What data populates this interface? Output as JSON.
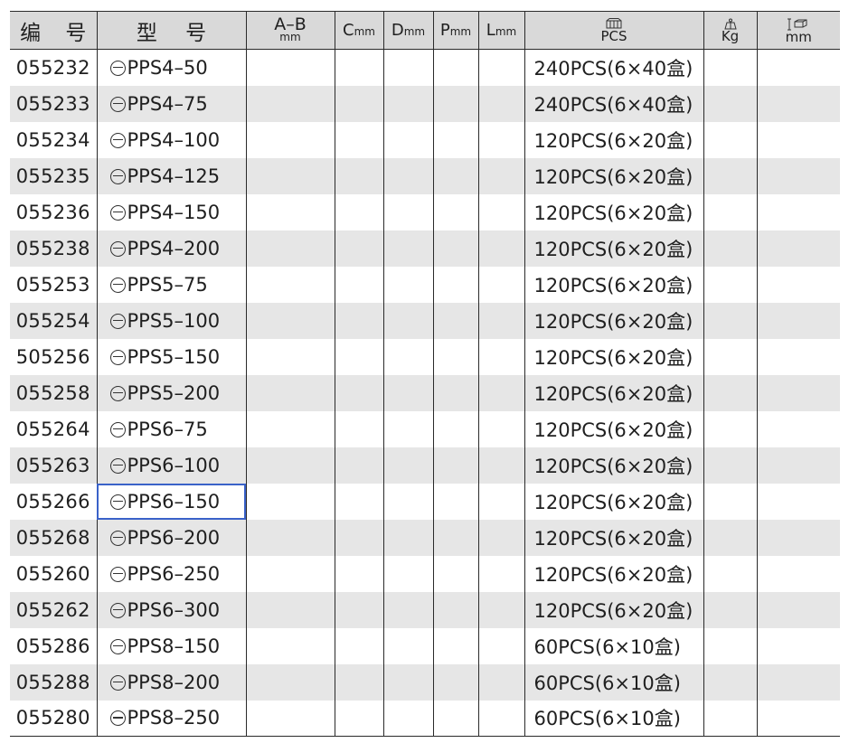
{
  "header": {
    "code": "编 号",
    "model": "型 号",
    "ab_main": "A–B",
    "ab_sub": "mm",
    "c_main": "C",
    "c_sub": "mm",
    "d_main": "D",
    "d_sub": "mm",
    "p_main": "P",
    "p_sub": "mm",
    "l_main": "L",
    "l_sub": "mm",
    "pcs": "PCS",
    "kg": "Kg",
    "box_mm": "mm"
  },
  "rows": [
    {
      "code": "055232",
      "model": "PPS4–50",
      "pack": "240PCS(6×40盒)"
    },
    {
      "code": "055233",
      "model": "PPS4–75",
      "pack": "240PCS(6×40盒)"
    },
    {
      "code": "055234",
      "model": "PPS4–100",
      "pack": "120PCS(6×20盒)"
    },
    {
      "code": "055235",
      "model": "PPS4–125",
      "pack": "120PCS(6×20盒)"
    },
    {
      "code": "055236",
      "model": "PPS4–150",
      "pack": "120PCS(6×20盒)"
    },
    {
      "code": "055238",
      "model": "PPS4–200",
      "pack": "120PCS(6×20盒)"
    },
    {
      "code": "055253",
      "model": "PPS5–75",
      "pack": "120PCS(6×20盒)"
    },
    {
      "code": "055254",
      "model": "PPS5–100",
      "pack": "120PCS(6×20盒)"
    },
    {
      "code": "505256",
      "model": "PPS5–150",
      "pack": "120PCS(6×20盒)"
    },
    {
      "code": "055258",
      "model": "PPS5–200",
      "pack": "120PCS(6×20盒)"
    },
    {
      "code": "055264",
      "model": "PPS6–75",
      "pack": "120PCS(6×20盒)"
    },
    {
      "code": "055263",
      "model": "PPS6–100",
      "pack": "120PCS(6×20盒)"
    },
    {
      "code": "055266",
      "model": "PPS6–150",
      "pack": "120PCS(6×20盒)"
    },
    {
      "code": "055268",
      "model": "PPS6–200",
      "pack": "120PCS(6×20盒)"
    },
    {
      "code": "055260",
      "model": "PPS6–250",
      "pack": "120PCS(6×20盒)"
    },
    {
      "code": "055262",
      "model": "PPS6–300",
      "pack": "120PCS(6×20盒)"
    },
    {
      "code": "055286",
      "model": "PPS8–150",
      "pack": "60PCS(6×10盒)"
    },
    {
      "code": "055288",
      "model": "PPS8–200",
      "pack": "60PCS(6×10盒)"
    },
    {
      "code": "055280",
      "model": "PPS8–250",
      "pack": "60PCS(6×10盒)"
    }
  ],
  "selected_row": 12,
  "colors": {
    "header_bg": "#d9d9d9",
    "shade_bg": "#e6e6e6",
    "selection": "#3a62c9"
  },
  "icons": {
    "pcs": "boxes-icon",
    "kg": "weight-scale-icon",
    "box_mm": "box-dimension-icon",
    "slot": "slotted-screwdriver-icon"
  }
}
